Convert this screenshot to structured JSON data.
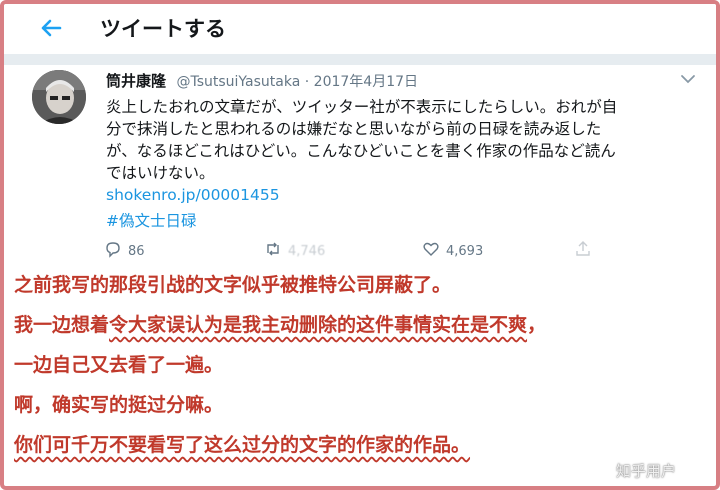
{
  "header": {
    "title": "ツイートする",
    "back_icon": "arrow-left-icon"
  },
  "tweet": {
    "display_name": "筒井康隆",
    "handle": "@TsutsuiYasutaka",
    "separator": "·",
    "date": "2017年4月17日",
    "lines": [
      "炎上したおれの文章だが、ツイッター社が不表示にしたらしい。おれが自",
      "分で抹消したと思われるのは嫌だなと思いながら前の日碌を読み返した",
      "が、なるほどこれはひどい。こんなひどいことを書く作家の作品など読ん",
      "ではいけない。"
    ],
    "link": "shokenro.jp/00001455",
    "hashtag": "#偽文士日碌",
    "replies": "86",
    "retweets": "4,746",
    "likes": "4,693"
  },
  "subtitles": {
    "line1": "之前我写的那段引战的文字似乎被推特公司屏蔽了。",
    "line2a": "我一边想着",
    "line2b": "令大家误认为是我主动删除的这件事情实在是不爽",
    "line2c": "，",
    "line3": "一边自己又去看了一遍。",
    "line4": "啊，确实写的挺过分嘛。",
    "line5": "你们可千万不要看写了这么过分的文字的作家的作品。"
  },
  "watermark": "知乎用户",
  "colors": {
    "frame": "#d87f84",
    "accent": "#1b95e0",
    "subtitle": "#c0392b"
  }
}
